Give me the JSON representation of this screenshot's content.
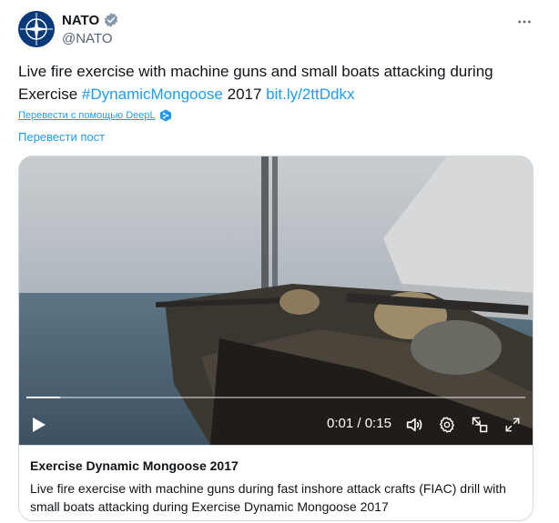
{
  "author": {
    "name": "NATO",
    "handle": "@NATO",
    "verified": true,
    "avatar_icon": "nato-compass-logo"
  },
  "tweet": {
    "text_before": "Live fire exercise with machine guns and small boats attacking during Exercise ",
    "hashtag": "#DynamicMongoose",
    "text_middle": " 2017 ",
    "link": "bit.ly/2ttDdkx"
  },
  "translation": {
    "deepl_label": "Перевести с помощью DeepL",
    "translate_post_label": "Перевести пост"
  },
  "video": {
    "current_time": "0:01",
    "separator": " / ",
    "duration": "0:15",
    "progress": 0.067
  },
  "card": {
    "title": "Exercise Dynamic Mongoose 2017",
    "description": "Live fire exercise with machine guns during fast inshore attack crafts (FIAC) drill with small boats attacking during Exercise Dynamic Mongoose 2017"
  },
  "colors": {
    "link": "#1d9bf0",
    "text": "#0f1419",
    "secondary": "#536471",
    "verified_badge": "#829aab"
  }
}
